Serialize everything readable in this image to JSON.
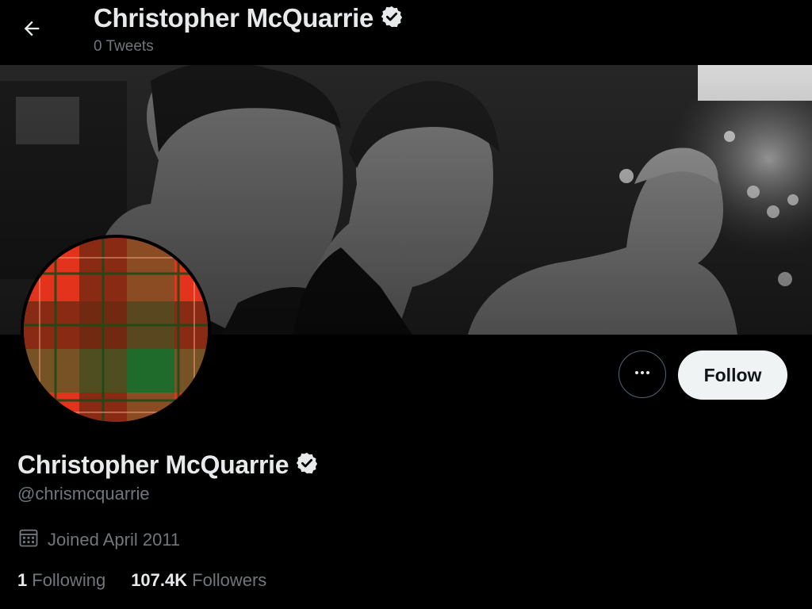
{
  "header": {
    "title": "Christopher McQuarrie",
    "subtitle": "0 Tweets",
    "back_icon": "arrow-left-icon",
    "verified_icon": "verified-badge-icon"
  },
  "profile": {
    "name": "Christopher McQuarrie",
    "handle": "@chrismcquarrie",
    "joined": "Joined April 2011",
    "calendar_icon": "calendar-icon",
    "following_count": "1",
    "following_label": "Following",
    "followers_count": "107.4K",
    "followers_label": "Followers"
  },
  "actions": {
    "more_icon": "more-options-icon",
    "follow_label": "Follow"
  },
  "colors": {
    "background": "#000000",
    "text_primary": "#e7e9ea",
    "text_secondary": "#71767b",
    "follow_button_bg": "#eff3f4",
    "avatar_red": "#e8361e",
    "avatar_green": "#1f6b2c"
  }
}
